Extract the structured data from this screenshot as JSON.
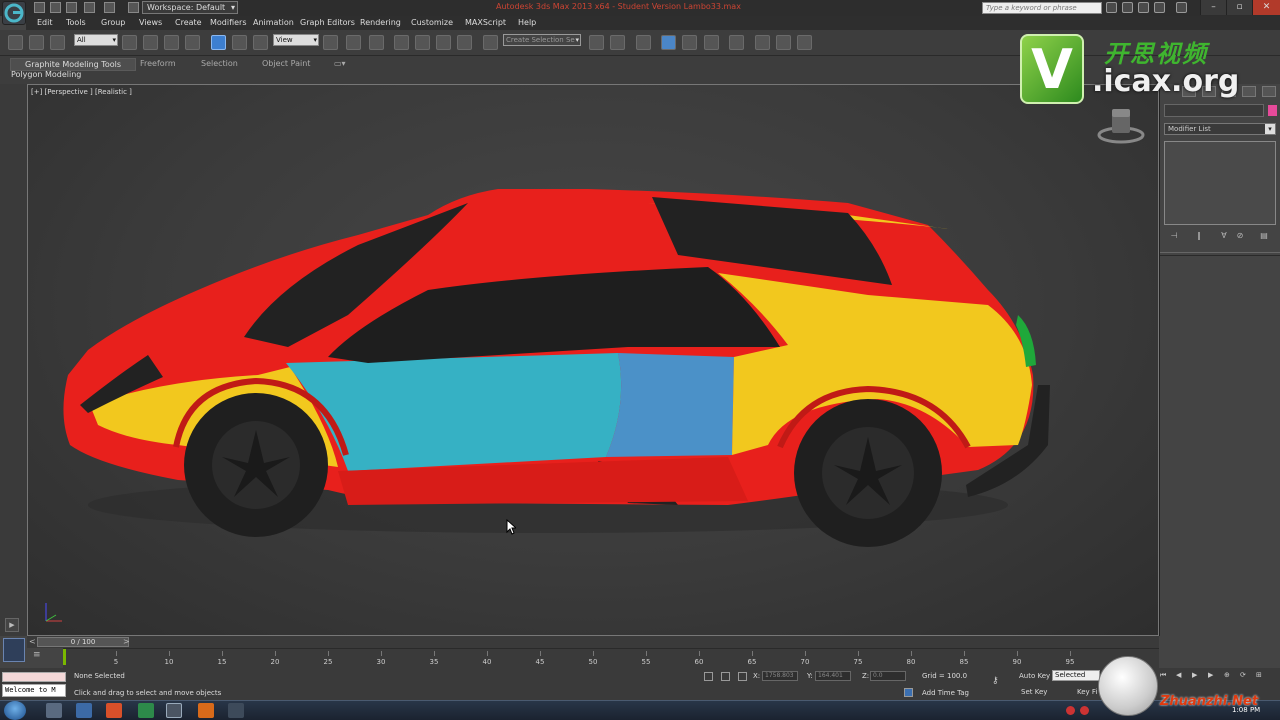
{
  "titlebar": {
    "workspace": "Workspace: Default",
    "window_title": "Autodesk 3ds Max  2013 x64   - Student Version    Lambo33.max",
    "search_placeholder": "Type a keyword or phrase"
  },
  "menu": [
    "Edit",
    "Tools",
    "Group",
    "Views",
    "Create",
    "Modifiers",
    "Animation",
    "Graph Editors",
    "Rendering",
    "Customize",
    "MAXScript",
    "Help"
  ],
  "toolbar": {
    "selection_filter": "All",
    "ref_coord": "View",
    "named_selection": "Create Selection Se"
  },
  "ribbon": {
    "tabs": [
      "Graphite Modeling Tools",
      "Freeform",
      "Selection",
      "Object Paint"
    ],
    "panel": "Polygon Modeling"
  },
  "viewport": {
    "label": "[+] [Perspective ] [Realistic ]",
    "car_colors": {
      "body": "#e8201c",
      "yellow": "#f2c81e",
      "cyan": "#36b1c4",
      "blue": "#4b91c8",
      "green": "#1fa83a",
      "glass": "#222222"
    }
  },
  "command_panel": {
    "modifier_list": "Modifier List",
    "swatch_color": "#e64a9a"
  },
  "timeline": {
    "frame_counter": "0 / 100",
    "ticks": [
      "5",
      "10",
      "15",
      "20",
      "25",
      "30",
      "35",
      "40",
      "45",
      "50",
      "55",
      "60",
      "65",
      "70",
      "75",
      "80",
      "85",
      "90",
      "95"
    ]
  },
  "status": {
    "welcome": "Welcome to M",
    "selection": "None Selected",
    "prompt": "Click and drag to select and move objects",
    "x_label": "X:",
    "x_value": "1758.803",
    "y_label": "Y:",
    "y_value": "164.401",
    "z_label": "Z:",
    "z_value": "0.0",
    "grid": "Grid = 100.0",
    "add_time_tag": "Add Time Tag",
    "auto_key": "Auto Key",
    "key_mode": "Selected",
    "set_key": "Set Key",
    "key_filters": "Key Fi"
  },
  "taskbar": {
    "clock": "1:08 PM"
  },
  "watermarks": {
    "icax_letter": "V",
    "icax_cn": "开思视频",
    "icax_domain": ".icax.org",
    "zhuanzhi": "Zhuanzhi.Net"
  }
}
